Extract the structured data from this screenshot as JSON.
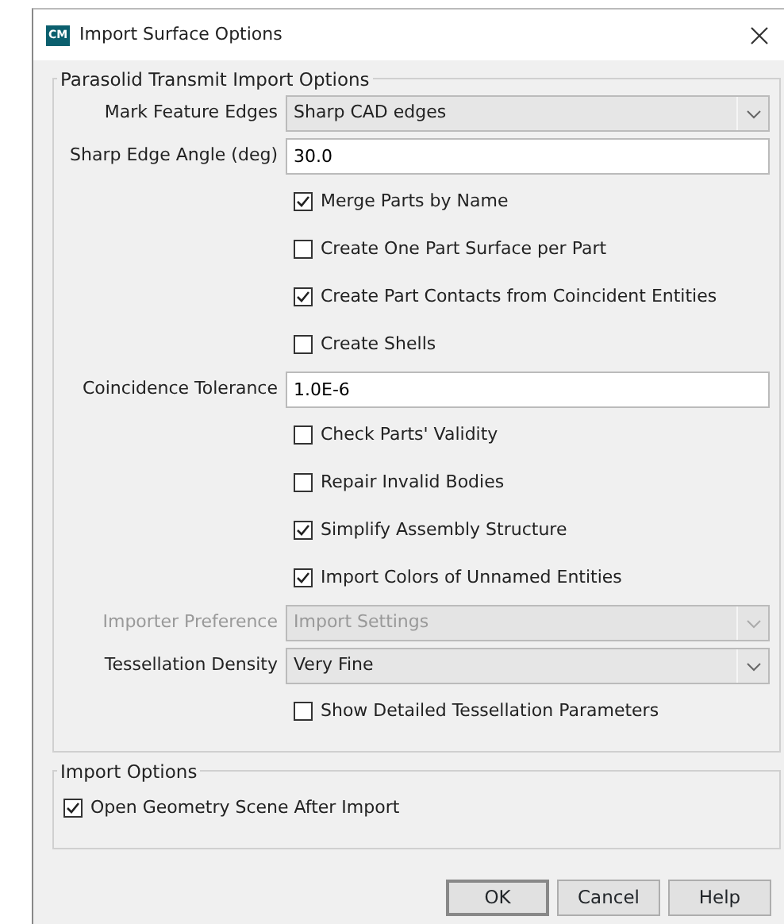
{
  "window": {
    "title": "Import Surface Options",
    "app_icon": "CM"
  },
  "groups": [
    {
      "title": "Parasolid Transmit Import Options",
      "rows": [
        {
          "kind": "select",
          "label": "Mark Feature Edges",
          "value": "Sharp CAD edges",
          "disabled": false
        },
        {
          "kind": "field",
          "label": "Sharp Edge Angle (deg)",
          "value": "30.0"
        },
        {
          "kind": "checkbox",
          "label": "Merge Parts by Name",
          "checked": true
        },
        {
          "kind": "checkbox",
          "label": "Create One Part Surface per Part",
          "checked": false
        },
        {
          "kind": "checkbox",
          "label": "Create Part Contacts from Coincident Entities",
          "checked": true
        },
        {
          "kind": "checkbox",
          "label": "Create Shells",
          "checked": false
        },
        {
          "kind": "field",
          "label": "Coincidence Tolerance",
          "value": "1.0E-6"
        },
        {
          "kind": "checkbox",
          "label": "Check Parts' Validity",
          "checked": false
        },
        {
          "kind": "checkbox",
          "label": "Repair Invalid Bodies",
          "checked": false
        },
        {
          "kind": "checkbox",
          "label": "Simplify Assembly Structure",
          "checked": true
        },
        {
          "kind": "checkbox",
          "label": "Import Colors of Unnamed Entities",
          "checked": true
        },
        {
          "kind": "select",
          "label": "Importer Preference",
          "value": "Import Settings",
          "disabled": true
        },
        {
          "kind": "select",
          "label": "Tessellation Density",
          "value": "Very Fine",
          "disabled": false
        },
        {
          "kind": "checkbox",
          "label": "Show Detailed Tessellation Parameters",
          "checked": false
        }
      ]
    },
    {
      "title": "Import Options",
      "rows": [
        {
          "kind": "checkbox",
          "label": "Open Geometry Scene After Import",
          "checked": true
        }
      ]
    }
  ],
  "buttons": [
    "OK",
    "Cancel",
    "Help"
  ]
}
